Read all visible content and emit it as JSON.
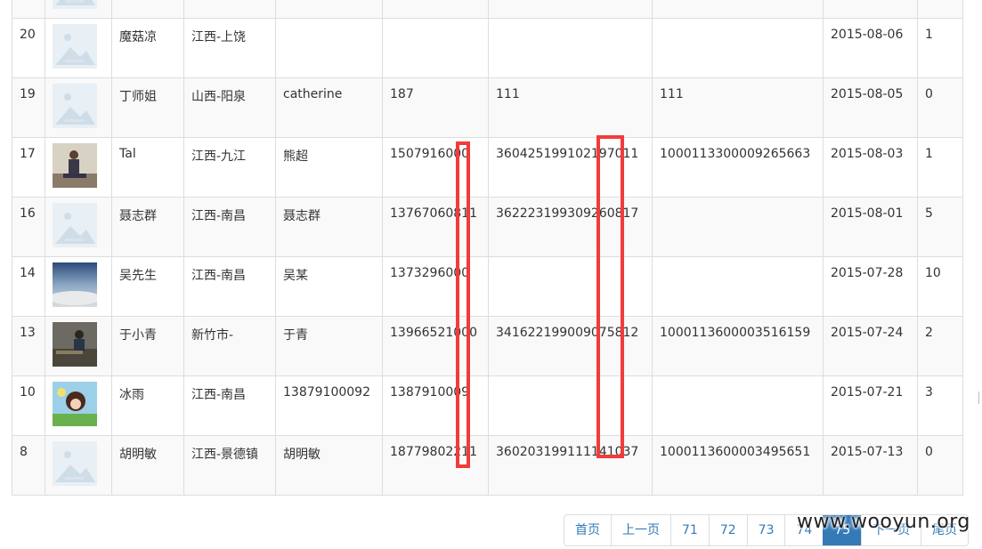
{
  "rows": [
    {
      "id": "",
      "photo": "placeholder",
      "name": "",
      "region": "",
      "real_name": "",
      "phone": "",
      "id_card": "",
      "account": "",
      "date": "",
      "count": ""
    },
    {
      "id": "20",
      "photo": "placeholder",
      "name": "魔菇凉",
      "region": "江西-上饶",
      "real_name": "",
      "phone": "",
      "id_card": "",
      "account": "",
      "date": "2015-08-06",
      "count": "1"
    },
    {
      "id": "19",
      "photo": "placeholder",
      "name": "丁师姐",
      "region": "山西-阳泉",
      "real_name": "catherine",
      "phone": "187",
      "id_card": "111",
      "account": "111",
      "date": "2015-08-05",
      "count": "0"
    },
    {
      "id": "17",
      "photo": "person-sitting",
      "name": "Tal",
      "region": "江西-九江",
      "real_name": "熊超",
      "phone": "1507916000",
      "id_card": "360425199102197011",
      "account": "1000113300009265663",
      "date": "2015-08-03",
      "count": "1"
    },
    {
      "id": "16",
      "photo": "placeholder",
      "name": "聂志群",
      "region": "江西-南昌",
      "real_name": "聂志群",
      "phone": "13767060811",
      "id_card": "362223199309260817",
      "account": "",
      "date": "2015-08-01",
      "count": "5"
    },
    {
      "id": "14",
      "photo": "sky-clouds",
      "name": "吴先生",
      "region": "江西-南昌",
      "real_name": "吴某",
      "phone": "1373296000",
      "id_card": "",
      "account": "",
      "date": "2015-07-28",
      "count": "10"
    },
    {
      "id": "13",
      "photo": "person-bench",
      "name": "于小青",
      "region": "新竹市-",
      "real_name": "于青",
      "phone": "13966521000",
      "id_card": "341622199009075812",
      "account": "1000113600003516159",
      "date": "2015-07-24",
      "count": "2"
    },
    {
      "id": "10",
      "photo": "cartoon-girl",
      "name": "冰雨",
      "region": "江西-南昌",
      "real_name": "13879100092",
      "phone": "1387910009",
      "id_card": "",
      "account": "",
      "date": "2015-07-21",
      "count": "3"
    },
    {
      "id": "8",
      "photo": "placeholder",
      "name": "胡明敏",
      "region": "江西-景德镇",
      "real_name": "胡明敏",
      "phone": "18779802211",
      "id_card": "360203199111141037",
      "account": "1000113600003495651",
      "date": "2015-07-13",
      "count": "0"
    }
  ],
  "pagination": {
    "first": "首页",
    "prev": "上一页",
    "pages": [
      "71",
      "72",
      "73",
      "74",
      "75"
    ],
    "active": "75",
    "next": "下一页",
    "last": "尾页"
  },
  "watermark": "www.wooyun.org",
  "colors": {
    "highlight": "#f23b3b",
    "link": "#337ab7",
    "stripe": "#f9f9f9",
    "border": "#dddddd"
  }
}
